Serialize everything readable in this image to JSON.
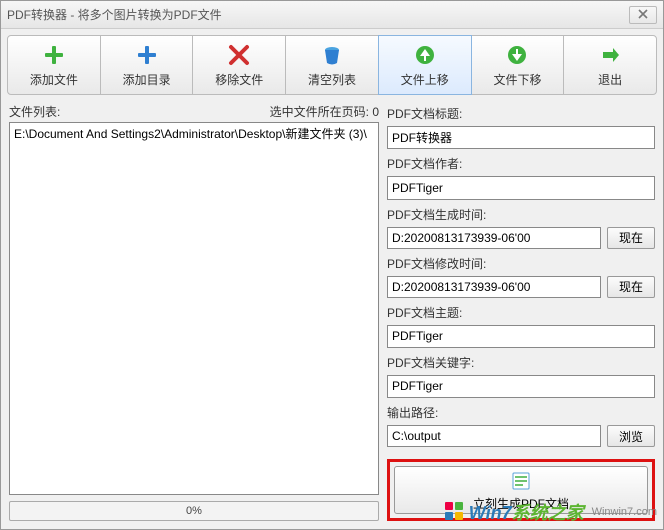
{
  "window": {
    "title": "PDF转换器 - 将多个图片转换为PDF文件"
  },
  "toolbar": {
    "add_file": "添加文件",
    "add_dir": "添加目录",
    "remove": "移除文件",
    "clear": "清空列表",
    "move_up": "文件上移",
    "move_down": "文件下移",
    "exit": "退出"
  },
  "left": {
    "file_list_label": "文件列表:",
    "page_info": "选中文件所在页码: 0",
    "entries": [
      "E:\\Document And Settings2\\Administrator\\Desktop\\新建文件夹 (3)\\"
    ],
    "progress_text": "0%"
  },
  "right": {
    "title_label": "PDF文档标题:",
    "title_value": "PDF转换器",
    "author_label": "PDF文档作者:",
    "author_value": "PDFTiger",
    "create_label": "PDF文档生成时间:",
    "create_value": "D:20200813173939-06'00",
    "modify_label": "PDF文档修改时间:",
    "modify_value": "D:20200813173939-06'00",
    "subject_label": "PDF文档主题:",
    "subject_value": "PDFTiger",
    "keywords_label": "PDF文档关键字:",
    "keywords_value": "PDFTiger",
    "output_label": "输出路径:",
    "output_value": "C:\\output",
    "now_btn": "现在",
    "browse_btn": "浏览",
    "generate_label": "立刻生成PDF文档"
  },
  "watermark": {
    "brand_a": "Win7",
    "brand_b": "系统之家",
    "url": "Winwin7.com"
  }
}
